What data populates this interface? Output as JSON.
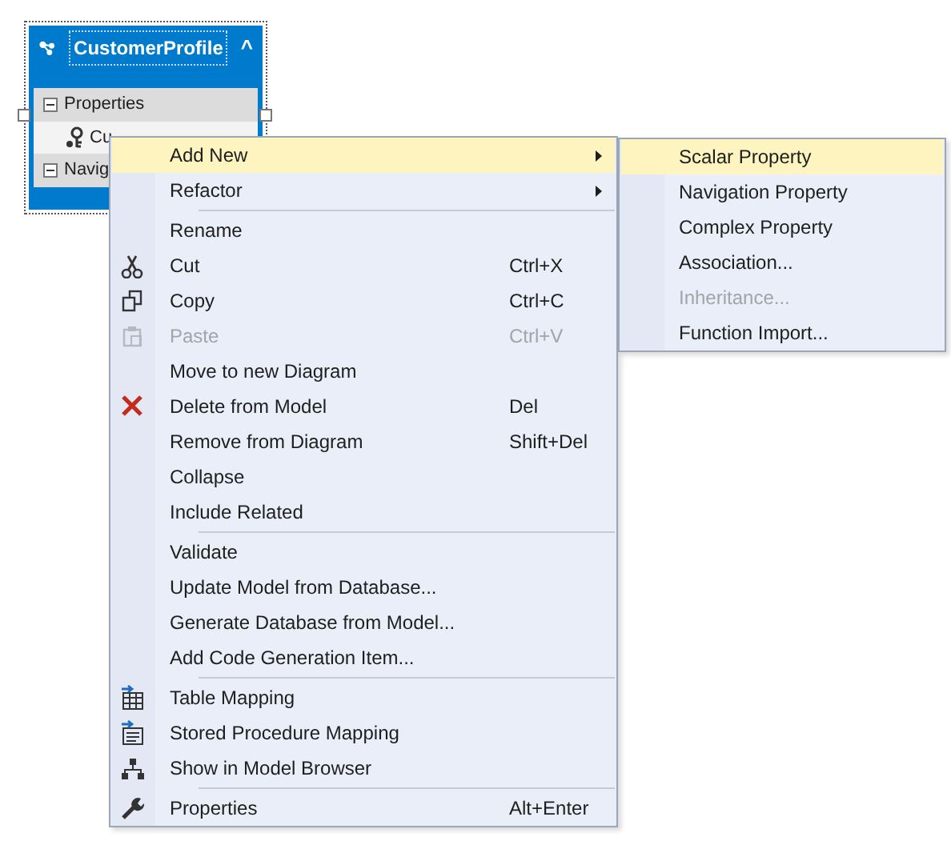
{
  "entity": {
    "title": "CustomerProfile",
    "collapse_glyph": "^",
    "sections": [
      {
        "label": "Properties",
        "expanded": true,
        "children": [
          {
            "label": "Cu"
          }
        ]
      },
      {
        "label": "Navig",
        "expanded": true
      }
    ]
  },
  "context_menu": {
    "items": [
      {
        "kind": "item",
        "label": "Add New",
        "submenu": true,
        "selected": true,
        "disabled": false
      },
      {
        "kind": "item",
        "label": "Refactor",
        "submenu": true,
        "selected": false,
        "disabled": false
      },
      {
        "kind": "separator"
      },
      {
        "kind": "item",
        "label": "Rename",
        "submenu": false,
        "selected": false,
        "disabled": false
      },
      {
        "kind": "item",
        "label": "Cut",
        "shortcut": "Ctrl+X",
        "submenu": false,
        "selected": false,
        "disabled": false
      },
      {
        "kind": "item",
        "label": "Copy",
        "shortcut": "Ctrl+C",
        "submenu": false,
        "selected": false,
        "disabled": false
      },
      {
        "kind": "item",
        "label": "Paste",
        "shortcut": "Ctrl+V",
        "submenu": false,
        "selected": false,
        "disabled": true
      },
      {
        "kind": "item",
        "label": "Move to new Diagram",
        "submenu": false,
        "selected": false,
        "disabled": false
      },
      {
        "kind": "item",
        "label": "Delete from Model",
        "shortcut": "Del",
        "submenu": false,
        "selected": false,
        "disabled": false
      },
      {
        "kind": "item",
        "label": "Remove from Diagram",
        "shortcut": "Shift+Del",
        "submenu": false,
        "selected": false,
        "disabled": false
      },
      {
        "kind": "item",
        "label": "Collapse",
        "submenu": false,
        "selected": false,
        "disabled": false
      },
      {
        "kind": "item",
        "label": "Include Related",
        "submenu": false,
        "selected": false,
        "disabled": false
      },
      {
        "kind": "separator"
      },
      {
        "kind": "item",
        "label": "Validate",
        "submenu": false,
        "selected": false,
        "disabled": false
      },
      {
        "kind": "item",
        "label": "Update Model from Database...",
        "submenu": false,
        "selected": false,
        "disabled": false
      },
      {
        "kind": "item",
        "label": "Generate Database from Model...",
        "submenu": false,
        "selected": false,
        "disabled": false
      },
      {
        "kind": "item",
        "label": "Add Code Generation Item...",
        "submenu": false,
        "selected": false,
        "disabled": false
      },
      {
        "kind": "separator"
      },
      {
        "kind": "item",
        "label": "Table Mapping",
        "submenu": false,
        "selected": false,
        "disabled": false
      },
      {
        "kind": "item",
        "label": "Stored Procedure Mapping",
        "submenu": false,
        "selected": false,
        "disabled": false
      },
      {
        "kind": "item",
        "label": "Show in Model Browser",
        "submenu": false,
        "selected": false,
        "disabled": false
      },
      {
        "kind": "separator"
      },
      {
        "kind": "item",
        "label": "Properties",
        "shortcut": "Alt+Enter",
        "submenu": false,
        "selected": false,
        "disabled": false
      }
    ]
  },
  "submenu": {
    "items": [
      {
        "label": "Scalar Property",
        "selected": true,
        "disabled": false
      },
      {
        "label": "Navigation Property",
        "selected": false,
        "disabled": false
      },
      {
        "label": "Complex Property",
        "selected": false,
        "disabled": false
      },
      {
        "label": "Association...",
        "selected": false,
        "disabled": false
      },
      {
        "label": "Inheritance...",
        "selected": false,
        "disabled": true
      },
      {
        "label": "Function Import...",
        "selected": false,
        "disabled": false
      }
    ]
  }
}
